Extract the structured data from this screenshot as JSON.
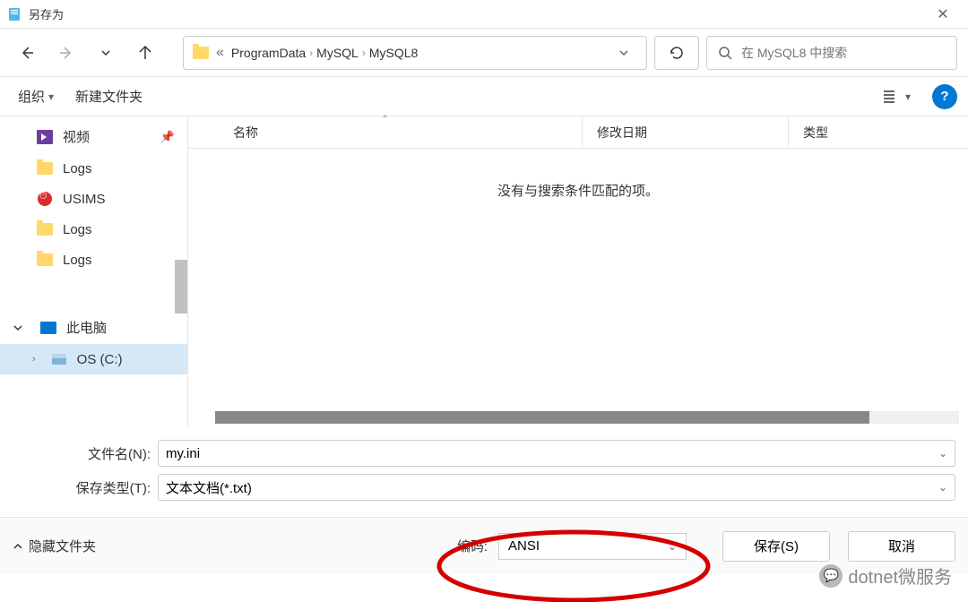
{
  "title": "另存为",
  "breadcrumb": {
    "ellipsis": "«",
    "items": [
      "ProgramData",
      "MySQL",
      "MySQL8"
    ]
  },
  "search": {
    "placeholder": "在 MySQL8 中搜索"
  },
  "toolbar": {
    "organize": "组织",
    "newFolder": "新建文件夹"
  },
  "sidebar": {
    "items": [
      {
        "label": "视频",
        "icon": "video",
        "pinned": true
      },
      {
        "label": "Logs",
        "icon": "folder"
      },
      {
        "label": "USIMS",
        "icon": "usims"
      },
      {
        "label": "Logs",
        "icon": "folder"
      },
      {
        "label": "Logs",
        "icon": "folder"
      }
    ],
    "thisPC": "此电脑",
    "osDrive": "OS (C:)"
  },
  "columns": {
    "name": "名称",
    "date": "修改日期",
    "type": "类型"
  },
  "content": {
    "emptyMessage": "没有与搜索条件匹配的项。"
  },
  "fields": {
    "filenameLabel": "文件名(N):",
    "filenameValue": "my.ini",
    "saveTypeLabel": "保存类型(T):",
    "saveTypeValue": "文本文档(*.txt)"
  },
  "footer": {
    "hideFolders": "隐藏文件夹",
    "encodingLabel": "编码:",
    "encodingValue": "ANSI",
    "save": "保存(S)",
    "cancel": "取消"
  },
  "watermark": "dotnet微服务"
}
